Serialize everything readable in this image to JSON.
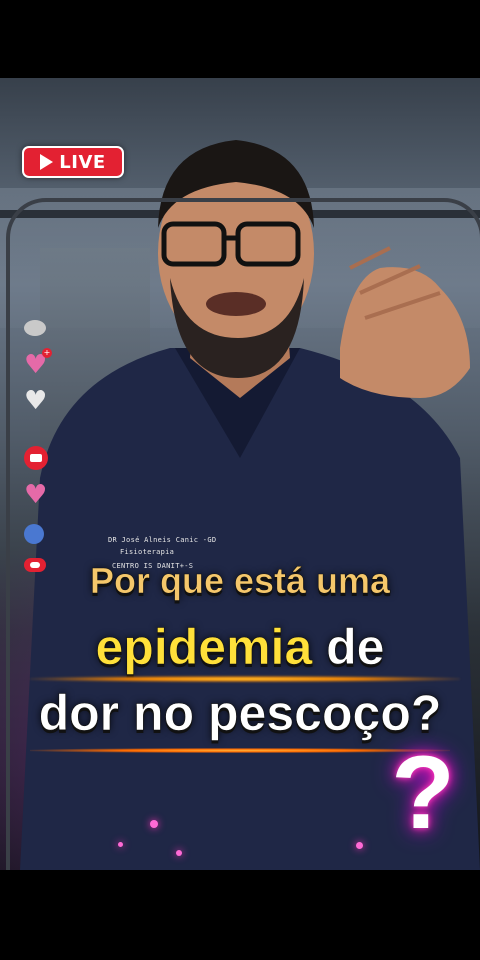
{
  "live_badge": {
    "label": "LIVE"
  },
  "side_icons": [
    "comment-icon",
    "heart-plus-icon",
    "heart-white-icon",
    "video-icon",
    "heart-pink-icon",
    "profile-dot-icon",
    "share-pill-icon"
  ],
  "scrub_text": {
    "line1": "DR José Alneis Canic -GD",
    "line2": "Fisioterapia",
    "line3": "CENTRO IS DANIT+-S"
  },
  "caption": {
    "line1": "Por que está uma",
    "line2_highlight": "epidemia",
    "line2_rest": " de",
    "line3": "dor no pescoço?"
  },
  "colors": {
    "live_red": "#e32132",
    "caption_yellow": "#ffe03a",
    "neon_pink": "#ff3cc8"
  },
  "question_mark": "?"
}
